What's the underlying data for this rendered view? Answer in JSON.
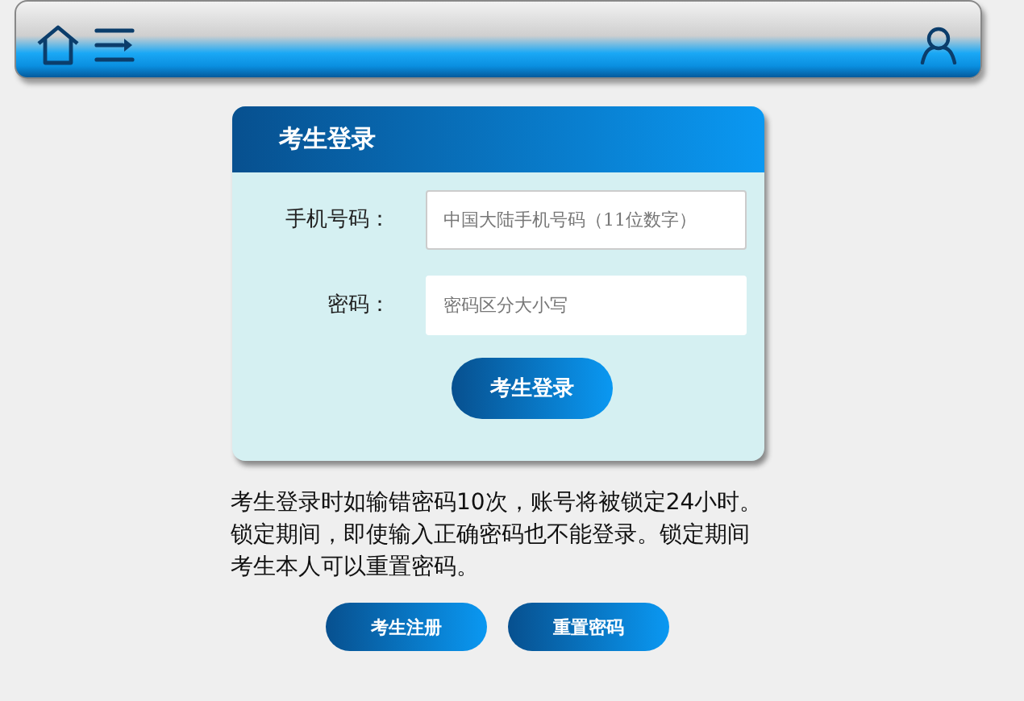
{
  "login": {
    "title": "考生登录",
    "fields": [
      {
        "label": "手机号码：",
        "placeholder": "中国大陆手机号码（11位数字）",
        "kind": "text"
      },
      {
        "label": "密码：",
        "placeholder": "密码区分大小写",
        "kind": "password"
      }
    ],
    "submit": "考生登录"
  },
  "notice": "考生登录时如输错密码10次，账号将被锁定24小时。锁定期间，即使输入正确密码也不能登录。锁定期间考生本人可以重置密码。",
  "actions": [
    "考生注册",
    "重置密码"
  ]
}
